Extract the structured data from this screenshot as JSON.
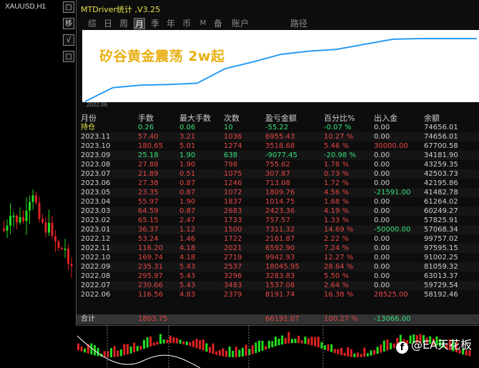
{
  "chart": {
    "symbol": "XAUUSD,H1"
  },
  "side_buttons": [
    "□",
    "移",
    "√",
    "□"
  ],
  "panel": {
    "title": "MTDriver统计 ,V3.25",
    "tabs": [
      {
        "label": "综",
        "active": false
      },
      {
        "label": "日",
        "active": false
      },
      {
        "label": "周",
        "active": false
      },
      {
        "label": "月",
        "active": true
      },
      {
        "label": "季",
        "active": false
      },
      {
        "label": "年",
        "active": false
      },
      {
        "label": "币",
        "active": false
      },
      {
        "label": "M",
        "active": false
      },
      {
        "label": "备",
        "active": false
      },
      {
        "label": "账户",
        "active": false
      },
      {
        "label": "路径",
        "active": false
      }
    ],
    "overlay_text": "矽谷黄金震荡 2w起",
    "growth_start_label": "2022.06"
  },
  "growth_curve": {
    "points": [
      0.0,
      0.22,
      0.26,
      0.27,
      0.29,
      0.52,
      0.63,
      0.75,
      0.8,
      0.83,
      0.91,
      0.99,
      1.0,
      1.0,
      1.0
    ]
  },
  "table": {
    "headers": [
      "月份",
      "手数",
      "最大手数",
      "次数",
      "盈亏金额",
      "百分比%",
      "出入金",
      "余额"
    ],
    "rows": [
      {
        "month": "持仓",
        "lots": "0.26",
        "max_lots": "0.06",
        "count": "10",
        "pnl": "-55.22",
        "pct": "-0.07 %",
        "flow": "0.00",
        "balance": "74656.01",
        "sign": "neg",
        "kind": "hold"
      },
      {
        "month": "2023.11",
        "lots": "57.40",
        "max_lots": "3.21",
        "count": "1036",
        "pnl": "6955.43",
        "pct": "10.27 %",
        "flow": "0.00",
        "balance": "74656.01",
        "sign": "pos"
      },
      {
        "month": "2023.10",
        "lots": "180.65",
        "max_lots": "5.01",
        "count": "1274",
        "pnl": "3518.68",
        "pct": "5.46 %",
        "flow": "30000.00",
        "balance": "67700.58",
        "sign": "pos",
        "flow_sign": "pos"
      },
      {
        "month": "2023.09",
        "lots": "25.18",
        "max_lots": "1.90",
        "count": "638",
        "pnl": "-9077.45",
        "pct": "-20.98 %",
        "flow": "0.00",
        "balance": "34181.90",
        "sign": "neg"
      },
      {
        "month": "2023.08",
        "lots": "27.88",
        "max_lots": "1.90",
        "count": "798",
        "pnl": "755.62",
        "pct": "1.78 %",
        "flow": "0.00",
        "balance": "43259.35",
        "sign": "pos"
      },
      {
        "month": "2023.07",
        "lots": "21.89",
        "max_lots": "0.51",
        "count": "1075",
        "pnl": "307.87",
        "pct": "0.73 %",
        "flow": "0.00",
        "balance": "42503.73",
        "sign": "pos"
      },
      {
        "month": "2023.06",
        "lots": "27.38",
        "max_lots": "0.87",
        "count": "1246",
        "pnl": "713.08",
        "pct": "1.72 %",
        "flow": "0.00",
        "balance": "42195.86",
        "sign": "pos"
      },
      {
        "month": "2023.05",
        "lots": "23.35",
        "max_lots": "0.87",
        "count": "1072",
        "pnl": "1809.76",
        "pct": "4.56 %",
        "flow": "-21591.00",
        "balance": "41482.78",
        "sign": "pos",
        "flow_sign": "neg"
      },
      {
        "month": "2023.04",
        "lots": "55.97",
        "max_lots": "1.90",
        "count": "1837",
        "pnl": "1014.75",
        "pct": "1.68 %",
        "flow": "0.00",
        "balance": "61264.02",
        "sign": "pos"
      },
      {
        "month": "2023.03",
        "lots": "64.59",
        "max_lots": "0.87",
        "count": "2683",
        "pnl": "2423.36",
        "pct": "4.19 %",
        "flow": "0.00",
        "balance": "60249.27",
        "sign": "pos"
      },
      {
        "month": "2023.02",
        "lots": "65.15",
        "max_lots": "2.47",
        "count": "1733",
        "pnl": "757.57",
        "pct": "1.33 %",
        "flow": "0.00",
        "balance": "57825.91",
        "sign": "pos"
      },
      {
        "month": "2023.01",
        "lots": "36.37",
        "max_lots": "1.12",
        "count": "1500",
        "pnl": "7311.32",
        "pct": "14.69 %",
        "flow": "-50000.00",
        "balance": "57068.34",
        "sign": "pos",
        "flow_sign": "neg"
      },
      {
        "month": "2022.12",
        "lots": "53.24",
        "max_lots": "1.46",
        "count": "1722",
        "pnl": "2161.87",
        "pct": "2.22 %",
        "flow": "0.00",
        "balance": "99757.02",
        "sign": "pos"
      },
      {
        "month": "2022.11",
        "lots": "116.20",
        "max_lots": "4.18",
        "count": "2021",
        "pnl": "6592.90",
        "pct": "7.24 %",
        "flow": "0.00",
        "balance": "97595.15",
        "sign": "pos"
      },
      {
        "month": "2022.10",
        "lots": "169.74",
        "max_lots": "4.18",
        "count": "2719",
        "pnl": "9942.93",
        "pct": "12.27 %",
        "flow": "0.00",
        "balance": "91002.25",
        "sign": "pos"
      },
      {
        "month": "2022.09",
        "lots": "235.31",
        "max_lots": "5.43",
        "count": "2537",
        "pnl": "18045.95",
        "pct": "28.64 %",
        "flow": "0.00",
        "balance": "81059.32",
        "sign": "pos"
      },
      {
        "month": "2022.08",
        "lots": "295.97",
        "max_lots": "5.43",
        "count": "3296",
        "pnl": "3283.83",
        "pct": "5.50 %",
        "flow": "0.00",
        "balance": "63013.37",
        "sign": "pos"
      },
      {
        "month": "2022.07",
        "lots": "230.66",
        "max_lots": "5.43",
        "count": "3483",
        "pnl": "1537.08",
        "pct": "2.64 %",
        "flow": "0.00",
        "balance": "59729.54",
        "sign": "pos"
      },
      {
        "month": "2022.06",
        "lots": "116.56",
        "max_lots": "4.83",
        "count": "2379",
        "pnl": "8191.74",
        "pct": "16.38 %",
        "flow": "28525.00",
        "balance": "58192.46",
        "sign": "pos",
        "flow_sign": "pos"
      }
    ],
    "total": {
      "month": "合计",
      "lots": "1803.75",
      "max_lots": "",
      "count": "",
      "pnl": "66191.07",
      "pct": "100.27 %",
      "flow": "-13066.00",
      "balance": ""
    }
  },
  "watermark": {
    "icon": "f",
    "text": "@EA天花板"
  },
  "colors": {
    "positive": "#e64646",
    "negative": "#35e07a",
    "title": "#e7e24a",
    "curve": "#2a9df4",
    "candle_bull": "#22dd22",
    "candle_bear": "#e02222"
  }
}
